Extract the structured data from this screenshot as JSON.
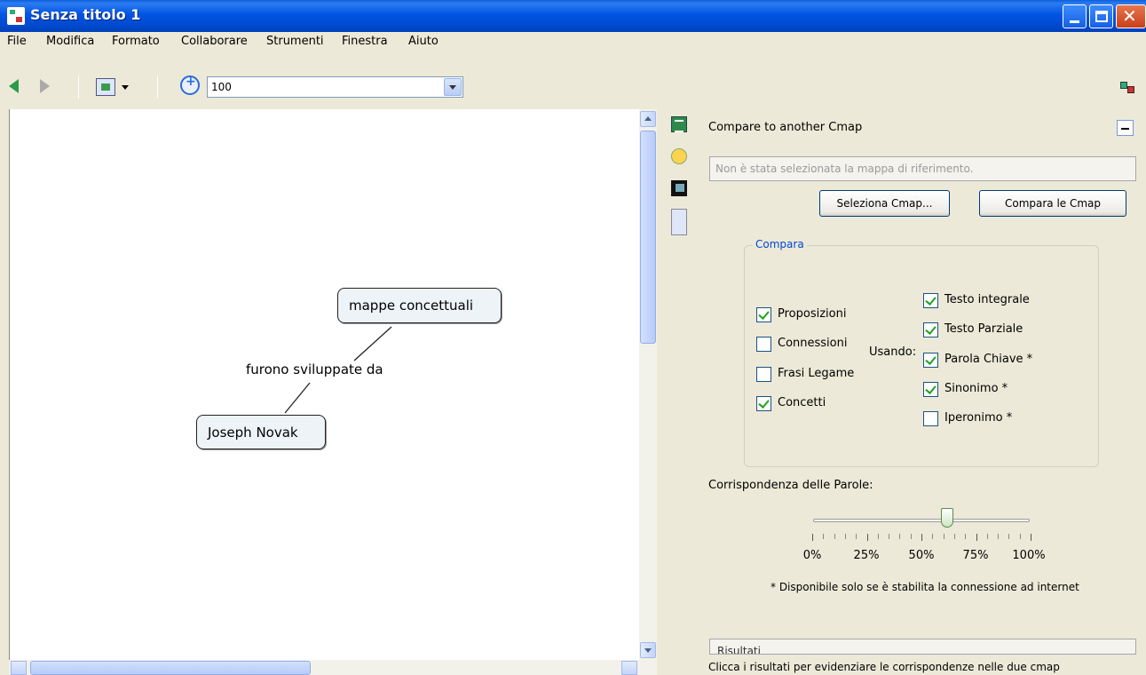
{
  "window": {
    "title": "Senza titolo 1"
  },
  "menu": [
    "File",
    "Modifica",
    "Formato",
    "Collaborare",
    "Strumenti",
    "Finestra",
    "Aiuto"
  ],
  "toolbar": {
    "zoom_value": "100"
  },
  "map": {
    "concepts": {
      "top": "mappe concettuali",
      "bottom": "Joseph Novak"
    },
    "link_phrase": "furono sviluppate da"
  },
  "panel": {
    "title": "Compare to another Cmap",
    "reference_placeholder": "Non è stata selezionata la mappa di riferimento.",
    "select_button": "Seleziona Cmap...",
    "compare_button": "Compara le Cmap",
    "group_title": "Compara",
    "compare_items": [
      {
        "label": "Proposizioni",
        "checked": true
      },
      {
        "label": "Connessioni",
        "checked": false
      },
      {
        "label": "Frasi Legame",
        "checked": false
      },
      {
        "label": "Concetti",
        "checked": true
      }
    ],
    "using_label": "Usando:",
    "using_items": [
      {
        "label": "Testo integrale",
        "checked": true
      },
      {
        "label": "Testo Parziale",
        "checked": true
      },
      {
        "label": "Parola Chiave *",
        "checked": true
      },
      {
        "label": "Sinonimo *",
        "checked": true
      },
      {
        "label": "Iperonimo *",
        "checked": false
      }
    ],
    "match_label": "Corrispondenza delle Parole:",
    "match_value_percent": 62,
    "slider_labels": [
      "0%",
      "25%",
      "50%",
      "75%",
      "100%"
    ],
    "note": "* Disponibile solo se è stabilita la connessione ad internet",
    "results_title": "Risultati",
    "results_hint": "Clicca i risultati per evidenziare le corrispondenze nelle due cmap"
  }
}
